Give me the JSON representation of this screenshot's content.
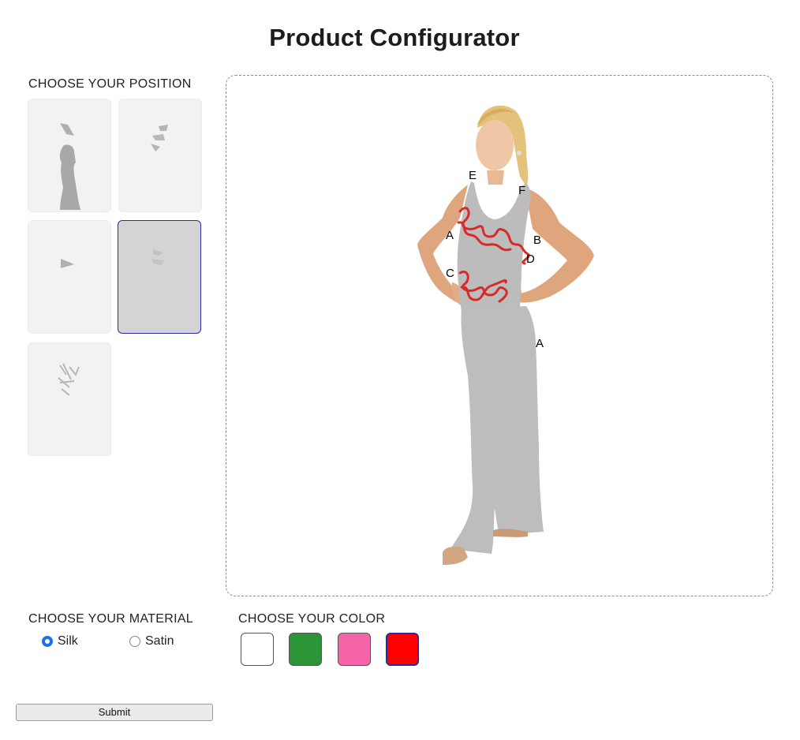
{
  "page": {
    "title": "Product Configurator"
  },
  "positions": {
    "label": "CHOOSE YOUR POSITION",
    "selected_index": 3,
    "count": 5
  },
  "preview": {
    "labels": [
      "E",
      "F",
      "A",
      "B",
      "D",
      "C",
      "A"
    ]
  },
  "material": {
    "label": "CHOOSE YOUR MATERIAL",
    "options": [
      "Silk",
      "Satin"
    ],
    "selected": "Silk"
  },
  "color": {
    "label": "CHOOSE YOUR COLOR",
    "swatches": [
      "#ffffff",
      "#2a9437",
      "#f564a9",
      "#ff0000"
    ],
    "selected_index": 3
  },
  "submit": {
    "label": "Submit"
  }
}
